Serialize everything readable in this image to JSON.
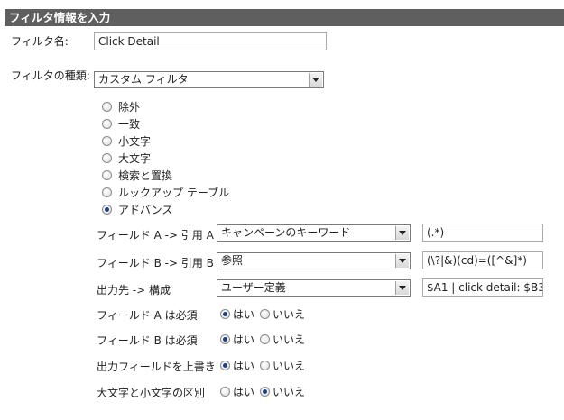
{
  "header": {
    "title": "フィルタ情報を入力"
  },
  "filter_name": {
    "label": "フィルタ名:",
    "value": "Click Detail"
  },
  "filter_type": {
    "label": "フィルタの種類:",
    "selected": "カスタム フィルタ"
  },
  "type_options": [
    {
      "label": "除外",
      "checked": false
    },
    {
      "label": "一致",
      "checked": false
    },
    {
      "label": "小文字",
      "checked": false
    },
    {
      "label": "大文字",
      "checked": false
    },
    {
      "label": "検索と置換",
      "checked": false
    },
    {
      "label": "ルックアップ テーブル",
      "checked": false
    },
    {
      "label": "アドバンス",
      "checked": true
    }
  ],
  "advanced": {
    "field_a": {
      "label": "フィールド A -> 引用 A",
      "selected": "キャンペーンのキーワード",
      "value": "(.*)"
    },
    "field_b": {
      "label": "フィールド B -> 引用 B",
      "selected": "参照",
      "value": "(\\?|&)(cd)=([^&]*)"
    },
    "output": {
      "label": "出力先 -> 構成",
      "selected": "ユーザー定義",
      "value": "$A1 | click detail: $B3"
    }
  },
  "yes_label": "はい",
  "no_label": "いいえ",
  "settings": [
    {
      "label": "フィールド A は必須",
      "yes": true
    },
    {
      "label": "フィールド B は必須",
      "yes": true
    },
    {
      "label": "出力フィールドを上書き",
      "yes": true
    },
    {
      "label": "大文字と小文字の区別",
      "yes": false
    }
  ]
}
